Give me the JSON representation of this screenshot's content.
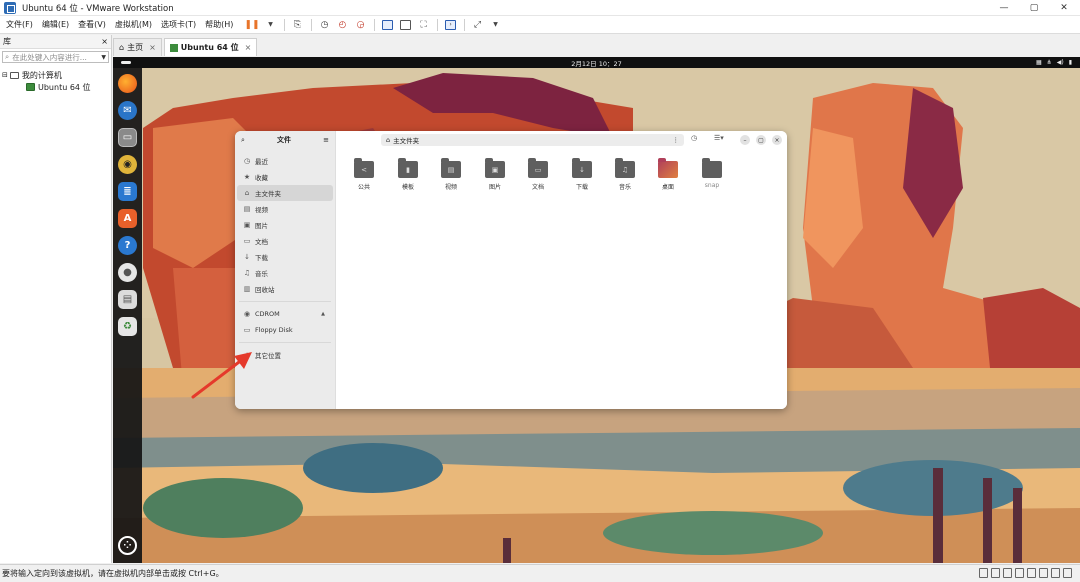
{
  "window": {
    "title": "Ubuntu 64 位 - VMware Workstation",
    "minimize": "—",
    "maximize": "▢",
    "close": "✕"
  },
  "menu": {
    "items": [
      "文件(F)",
      "编辑(E)",
      "查看(V)",
      "虚拟机(M)",
      "选项卡(T)",
      "帮助(H)"
    ]
  },
  "library": {
    "title": "库",
    "close": "×",
    "search_placeholder": "在此处键入内容进行...",
    "tree": {
      "root": "我的计算机",
      "vm": "Ubuntu 64 位"
    }
  },
  "tabs": [
    {
      "label": "主页",
      "close": "×"
    },
    {
      "label": "Ubuntu 64 位",
      "close": "×"
    }
  ],
  "vm_topbar": {
    "clock": "2月12日 10：27"
  },
  "files_window": {
    "sidebar_title": "文件",
    "sidebar_items": [
      {
        "label": "最近",
        "glyph": "◷"
      },
      {
        "label": "收藏",
        "glyph": "★"
      },
      {
        "label": "主文件夹",
        "glyph": "⌂"
      },
      {
        "label": "视频",
        "glyph": "▤"
      },
      {
        "label": "图片",
        "glyph": "▣"
      },
      {
        "label": "文档",
        "glyph": "▭"
      },
      {
        "label": "下载",
        "glyph": "↓"
      },
      {
        "label": "音乐",
        "glyph": "♫"
      },
      {
        "label": "回收站",
        "glyph": "▥"
      }
    ],
    "devices": [
      {
        "label": "CDROM",
        "glyph": "◉",
        "eject": "▲"
      },
      {
        "label": "Floppy Disk",
        "glyph": "▭"
      }
    ],
    "other_locations": {
      "label": "其它位置",
      "glyph": "+"
    },
    "path": "主文件夹",
    "folders": [
      {
        "label": "公共",
        "glyph": "<"
      },
      {
        "label": "模板",
        "glyph": "▮"
      },
      {
        "label": "视频",
        "glyph": "▤"
      },
      {
        "label": "图片",
        "glyph": "▣"
      },
      {
        "label": "文档",
        "glyph": "▭"
      },
      {
        "label": "下载",
        "glyph": "↓"
      },
      {
        "label": "音乐",
        "glyph": "♫"
      },
      {
        "label": "桌面",
        "glyph": ""
      },
      {
        "label": "snap",
        "glyph": ""
      }
    ]
  },
  "statusbar": {
    "text": "要将输入定向到该虚拟机，请在虚拟机内部单击或按 Ctrl+G。"
  },
  "colors": {
    "accent_orange": "#e8742a",
    "dock_bg": "#141414",
    "arrow_red": "#e5392b"
  }
}
